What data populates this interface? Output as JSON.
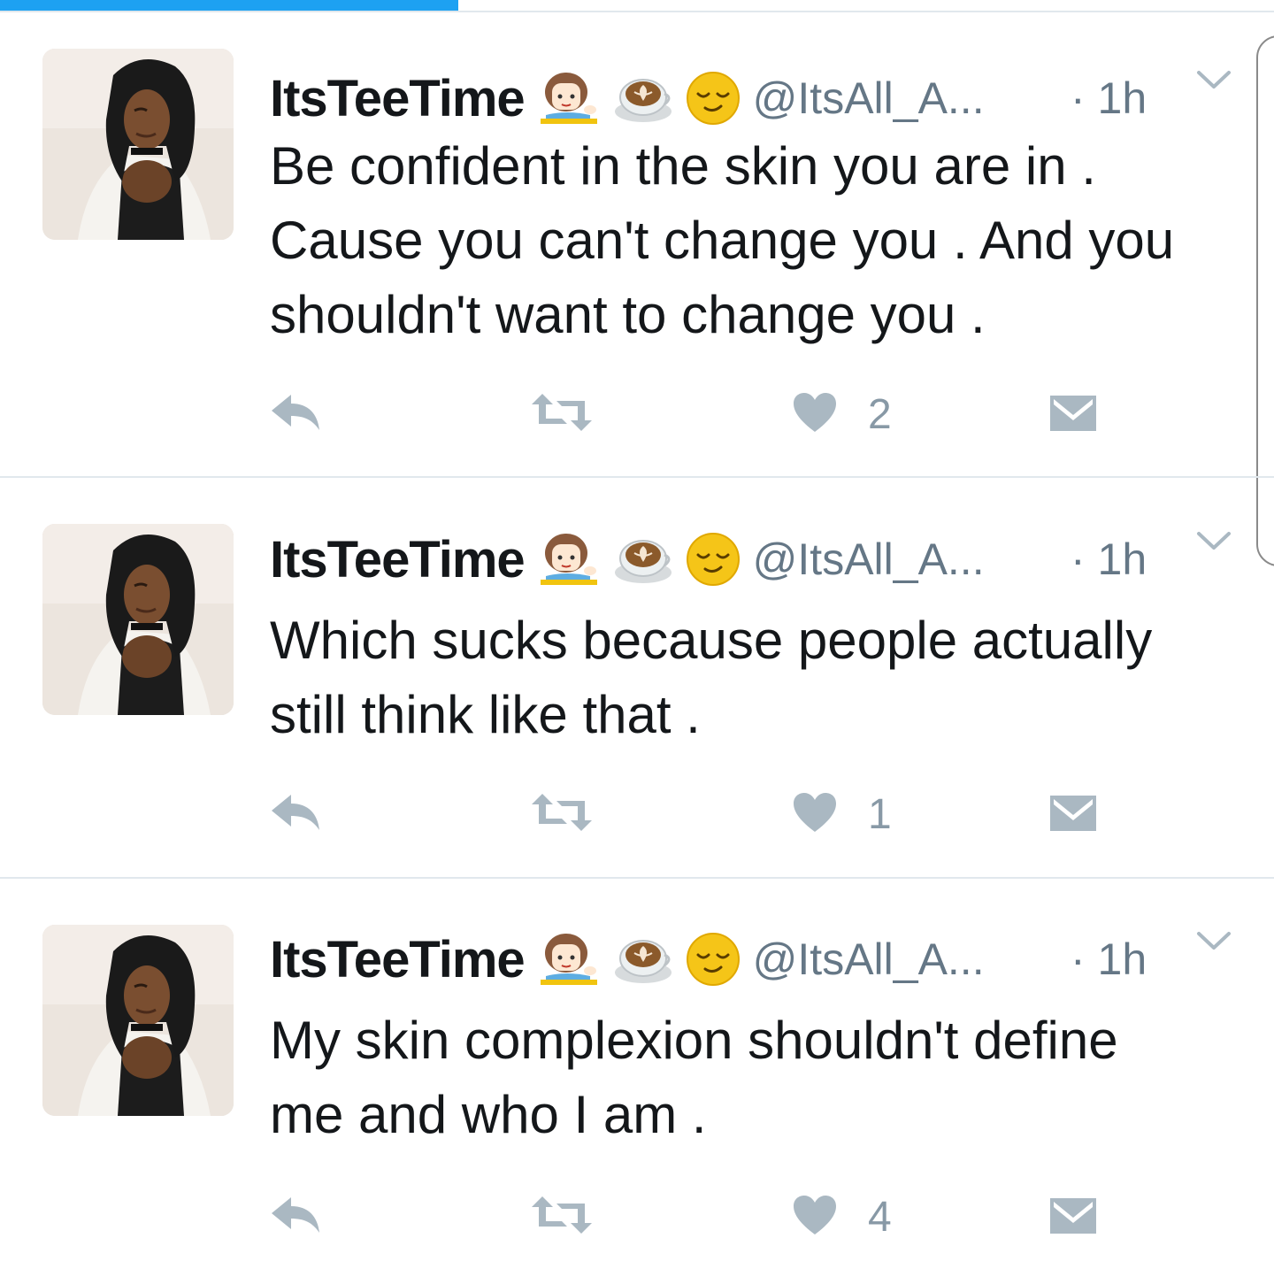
{
  "progress": {
    "fraction": 0.36,
    "color": "#1da1f2"
  },
  "colors": {
    "text": "#14171a",
    "secondary": "#657786",
    "icon": "#aab8c2",
    "divider": "#e1e8ed"
  },
  "tweets": [
    {
      "display_name": "ItsTeeTime",
      "emojis": [
        "woman-tipping-hand-icon",
        "latte-icon",
        "relieved-face-icon"
      ],
      "handle": "@ItsAll_A...",
      "time": "· 1h",
      "lines": [
        "Be confident in the skin you are in .",
        "Cause you can't change you . And you",
        "shouldn't want to change you ."
      ],
      "like_count": "2"
    },
    {
      "display_name": "ItsTeeTime",
      "emojis": [
        "woman-tipping-hand-icon",
        "latte-icon",
        "relieved-face-icon"
      ],
      "handle": "@ItsAll_A...",
      "time": "· 1h",
      "lines": [
        "Which sucks because people actually",
        "still think like that ."
      ],
      "like_count": "1"
    },
    {
      "display_name": "ItsTeeTime",
      "emojis": [
        "woman-tipping-hand-icon",
        "latte-icon",
        "relieved-face-icon"
      ],
      "handle": "@ItsAll_A...",
      "time": "· 1h",
      "lines": [
        "My skin complexion shouldn't define",
        "me and who I am ."
      ],
      "like_count": "4"
    }
  ]
}
